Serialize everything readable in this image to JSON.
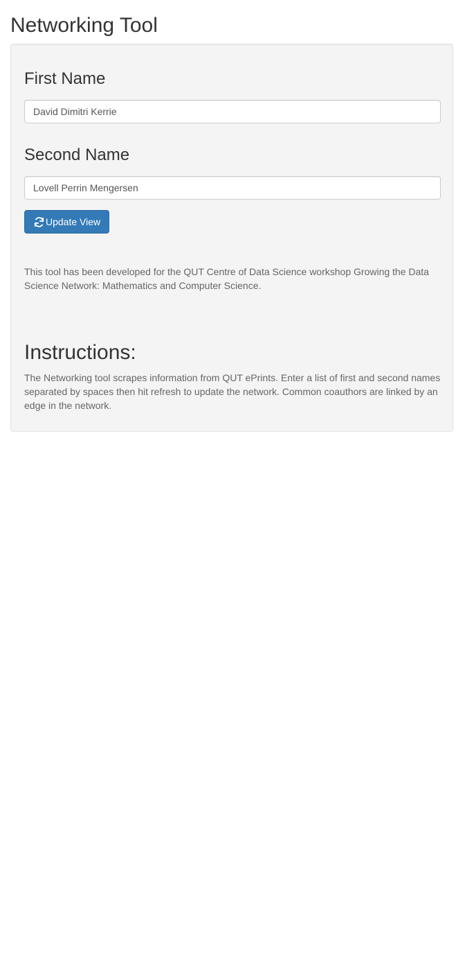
{
  "page": {
    "title": "Networking Tool"
  },
  "form": {
    "first_name_label": "First Name",
    "first_name_value": "David Dimitri Kerrie",
    "second_name_label": "Second Name",
    "second_name_value": "Lovell Perrin Mengersen",
    "update_button_label": "Update View",
    "update_button_icon": "refresh-icon",
    "button_color": "#337ab7"
  },
  "info": {
    "intro": "This tool has been developed for the QUT Centre of Data Science workshop Growing the Data Science Network: Mathematics and Computer Science.",
    "instructions_title": "Instructions:",
    "instructions_body": "The Networking tool scrapes information from QUT ePrints. Enter a list of first and second names separated by spaces then hit refresh to update the network. Common coauthors are linked by an edge in the network."
  }
}
